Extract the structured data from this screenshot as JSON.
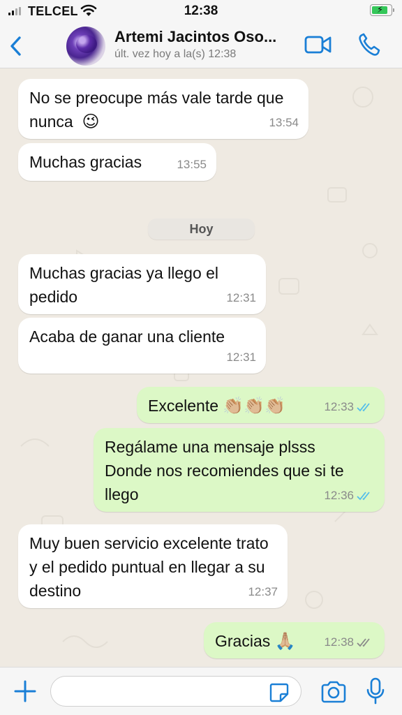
{
  "status_bar": {
    "carrier": "TELCEL",
    "time": "12:38"
  },
  "header": {
    "contact_name": "Artemi Jacintos Oso...",
    "last_seen": "últ. vez hoy a la(s) 12:38"
  },
  "date_divider": "Hoy",
  "messages": [
    {
      "direction": "in",
      "text": "No se preocupe  más vale tarde que nunca",
      "emoji": "😉",
      "time": "13:54"
    },
    {
      "direction": "in",
      "text": "Muchas gracias",
      "time": "13:55"
    },
    {
      "direction": "in",
      "text": "Muchas gracias ya llego el pedido",
      "time": "12:31"
    },
    {
      "direction": "in",
      "text": "Acaba de ganar una cliente",
      "time": "12:31"
    },
    {
      "direction": "out",
      "text": "Excelente",
      "emoji": "👏🏼👏🏼👏🏼",
      "time": "12:33",
      "status": "read"
    },
    {
      "direction": "out",
      "text": "Regálame una mensaje plsss Donde nos recomiendes que si te llego",
      "time": "12:36",
      "status": "read"
    },
    {
      "direction": "in",
      "text": "Muy buen servicio  excelente trato y el pedido  puntual en llegar  a su destino",
      "time": "12:37"
    },
    {
      "direction": "out",
      "text": "Gracias",
      "emoji": "🙏🏼",
      "time": "12:38",
      "status": "delivered"
    }
  ],
  "input": {
    "placeholder": ""
  },
  "colors": {
    "accent": "#1a7fd6",
    "incoming_bubble": "#ffffff",
    "outgoing_bubble": "#dcf8c6",
    "chat_background": "#efeae2",
    "read_ticks": "#53bdeb",
    "delivered_ticks": "#8a8a8a"
  },
  "icons": [
    "back-chevron-icon",
    "video-call-icon",
    "phone-icon",
    "plus-icon",
    "sticker-icon",
    "camera-icon",
    "microphone-icon",
    "wifi-icon",
    "battery-icon",
    "signal-icon"
  ]
}
